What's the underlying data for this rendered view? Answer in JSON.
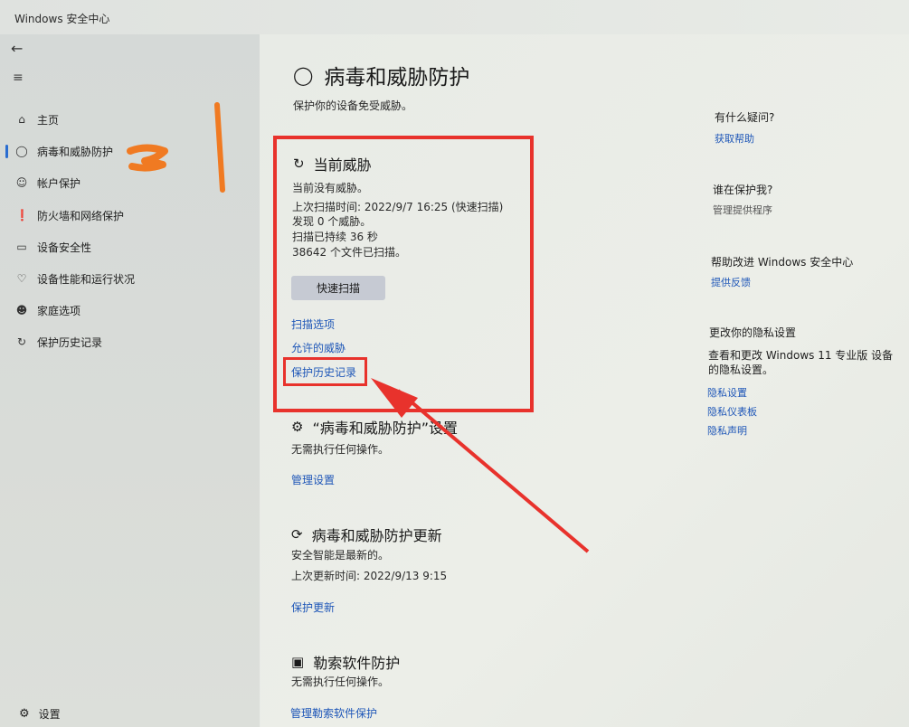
{
  "window": {
    "title": "Windows 安全中心",
    "minimize": "–",
    "maximize": "□"
  },
  "sidebar": {
    "back_icon": "back-arrow-icon",
    "menu_icon": "hamburger-icon",
    "items": [
      {
        "label": "主页",
        "icon": "home-icon"
      },
      {
        "label": "病毒和威胁防护",
        "icon": "shield-icon",
        "active": true
      },
      {
        "label": "帐户保护",
        "icon": "person-icon"
      },
      {
        "label": "防火墙和网络保护",
        "icon": "wifi-icon"
      },
      {
        "label": "设备安全性",
        "icon": "laptop-icon"
      },
      {
        "label": "设备性能和运行状况",
        "icon": "heart-icon"
      },
      {
        "label": "家庭选项",
        "icon": "family-icon"
      },
      {
        "label": "保护历史记录",
        "icon": "history-icon"
      }
    ],
    "settings_label": "设置"
  },
  "main": {
    "title": "病毒和威胁防护",
    "subtitle": "保护你的设备免受威胁。",
    "current_threats": {
      "title": "当前威胁",
      "status": "当前没有威胁。",
      "last_scan": "上次扫描时间: 2022/9/7 16:25 (快速扫描)",
      "found": "发现 0 个威胁。",
      "duration": "扫描已持续 36 秒",
      "files": "38642 个文件已扫描。",
      "quick_scan_button": "快速扫描",
      "links": [
        "扫描选项",
        "允许的威胁",
        "保护历史记录"
      ]
    },
    "settings_section": {
      "title": "“病毒和威胁防护”设置",
      "text": "无需执行任何操作。",
      "link": "管理设置"
    },
    "updates_section": {
      "title": "病毒和威胁防护更新",
      "text": "安全智能是最新的。",
      "last_update": "上次更新时间: 2022/9/13 9:15",
      "link": "保护更新"
    },
    "ransomware_section": {
      "title": "勒索软件防护",
      "text": "无需执行任何操作。",
      "link": "管理勒索软件保护"
    }
  },
  "right_panel": {
    "q1": "有什么疑问?",
    "q1_link": "获取帮助",
    "q2": "谁在保护我?",
    "q2_link": "管理提供程序",
    "q3": "帮助改进 Windows 安全中心",
    "q3_link": "提供反馈",
    "q4": "更改你的隐私设置",
    "q4_text": "查看和更改 Windows 11 专业版 设备的隐私设置。",
    "q4_links": [
      "隐私设置",
      "隐私仪表板",
      "隐私声明"
    ]
  },
  "colors": {
    "accent": "#2a6dd0",
    "link": "#1f57b8",
    "annotation_red": "#e8322c",
    "annotation_orange": "#f07a22"
  }
}
